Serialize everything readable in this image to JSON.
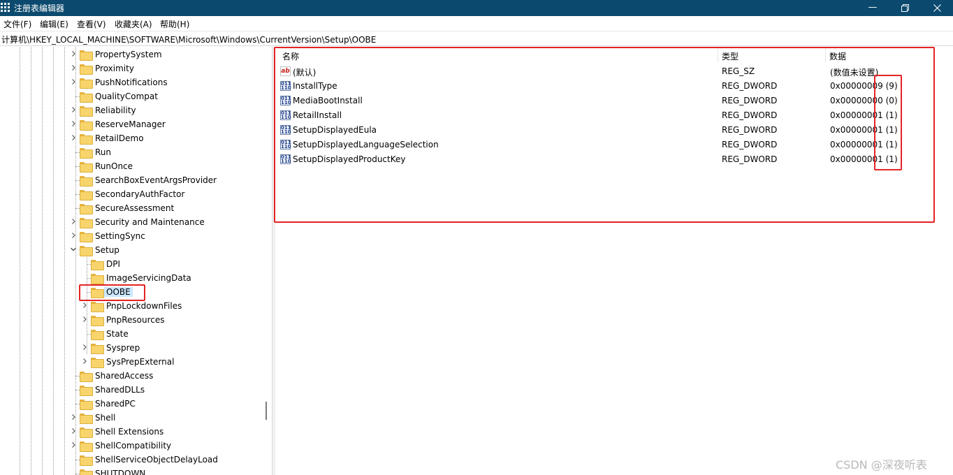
{
  "window": {
    "title": "注册表编辑器",
    "icon": "regedit-icon",
    "controls": [
      "minimize-icon",
      "restore-icon",
      "close-icon"
    ],
    "titlebar_color": "#0b4a6e"
  },
  "menu": [
    "文件(F)",
    "编辑(E)",
    "查看(V)",
    "收藏夹(A)",
    "帮助(H)"
  ],
  "address": "计算机\\HKEY_LOCAL_MACHINE\\SOFTWARE\\Microsoft\\Windows\\CurrentVersion\\Setup\\OOBE",
  "tree": {
    "items": [
      {
        "label": "PropertySystem",
        "level": 1,
        "expander": "collapsed"
      },
      {
        "label": "Proximity",
        "level": 1,
        "expander": "collapsed"
      },
      {
        "label": "PushNotifications",
        "level": 1,
        "expander": "collapsed"
      },
      {
        "label": "QualityCompat",
        "level": 1,
        "expander": "none"
      },
      {
        "label": "Reliability",
        "level": 1,
        "expander": "collapsed"
      },
      {
        "label": "ReserveManager",
        "level": 1,
        "expander": "collapsed"
      },
      {
        "label": "RetailDemo",
        "level": 1,
        "expander": "collapsed"
      },
      {
        "label": "Run",
        "level": 1,
        "expander": "none"
      },
      {
        "label": "RunOnce",
        "level": 1,
        "expander": "none"
      },
      {
        "label": "SearchBoxEventArgsProvider",
        "level": 1,
        "expander": "none"
      },
      {
        "label": "SecondaryAuthFactor",
        "level": 1,
        "expander": "none"
      },
      {
        "label": "SecureAssessment",
        "level": 1,
        "expander": "none"
      },
      {
        "label": "Security and Maintenance",
        "level": 1,
        "expander": "collapsed"
      },
      {
        "label": "SettingSync",
        "level": 1,
        "expander": "collapsed"
      },
      {
        "label": "Setup",
        "level": 1,
        "expander": "expanded"
      },
      {
        "label": "DPI",
        "level": 2,
        "expander": "none"
      },
      {
        "label": "ImageServicingData",
        "level": 2,
        "expander": "none"
      },
      {
        "label": "OOBE",
        "level": 2,
        "expander": "none",
        "selected": true
      },
      {
        "label": "PnpLockdownFiles",
        "level": 2,
        "expander": "collapsed"
      },
      {
        "label": "PnpResources",
        "level": 2,
        "expander": "collapsed"
      },
      {
        "label": "State",
        "level": 2,
        "expander": "none"
      },
      {
        "label": "Sysprep",
        "level": 2,
        "expander": "collapsed"
      },
      {
        "label": "SysPrepExternal",
        "level": 2,
        "expander": "collapsed"
      },
      {
        "label": "SharedAccess",
        "level": 1,
        "expander": "none"
      },
      {
        "label": "SharedDLLs",
        "level": 1,
        "expander": "none"
      },
      {
        "label": "SharedPC",
        "level": 1,
        "expander": "none"
      },
      {
        "label": "Shell",
        "level": 1,
        "expander": "collapsed"
      },
      {
        "label": "Shell Extensions",
        "level": 1,
        "expander": "collapsed"
      },
      {
        "label": "ShellCompatibility",
        "level": 1,
        "expander": "collapsed"
      },
      {
        "label": "ShellServiceObjectDelayLoad",
        "level": 1,
        "expander": "none"
      },
      {
        "label": "SHUTDOWN",
        "level": 1,
        "expander": "none"
      }
    ]
  },
  "values": {
    "columns": [
      "名称",
      "类型",
      "数据"
    ],
    "rows": [
      {
        "icon": "string-value-icon",
        "name": "(默认)",
        "type": "REG_SZ",
        "data": "(数值未设置)"
      },
      {
        "icon": "dword-value-icon",
        "name": "InstallType",
        "type": "REG_DWORD",
        "data": "0x00000009 (9)"
      },
      {
        "icon": "dword-value-icon",
        "name": "MediaBootInstall",
        "type": "REG_DWORD",
        "data": "0x00000000 (0)"
      },
      {
        "icon": "dword-value-icon",
        "name": "RetailInstall",
        "type": "REG_DWORD",
        "data": "0x00000001 (1)"
      },
      {
        "icon": "dword-value-icon",
        "name": "SetupDisplayedEula",
        "type": "REG_DWORD",
        "data": "0x00000001 (1)"
      },
      {
        "icon": "dword-value-icon",
        "name": "SetupDisplayedLanguageSelection",
        "type": "REG_DWORD",
        "data": "0x00000001 (1)"
      },
      {
        "icon": "dword-value-icon",
        "name": "SetupDisplayedProductKey",
        "type": "REG_DWORD",
        "data": "0x00000001 (1)"
      }
    ]
  },
  "annotation_color": "#e42323",
  "watermark": "CSDN @深夜听表"
}
